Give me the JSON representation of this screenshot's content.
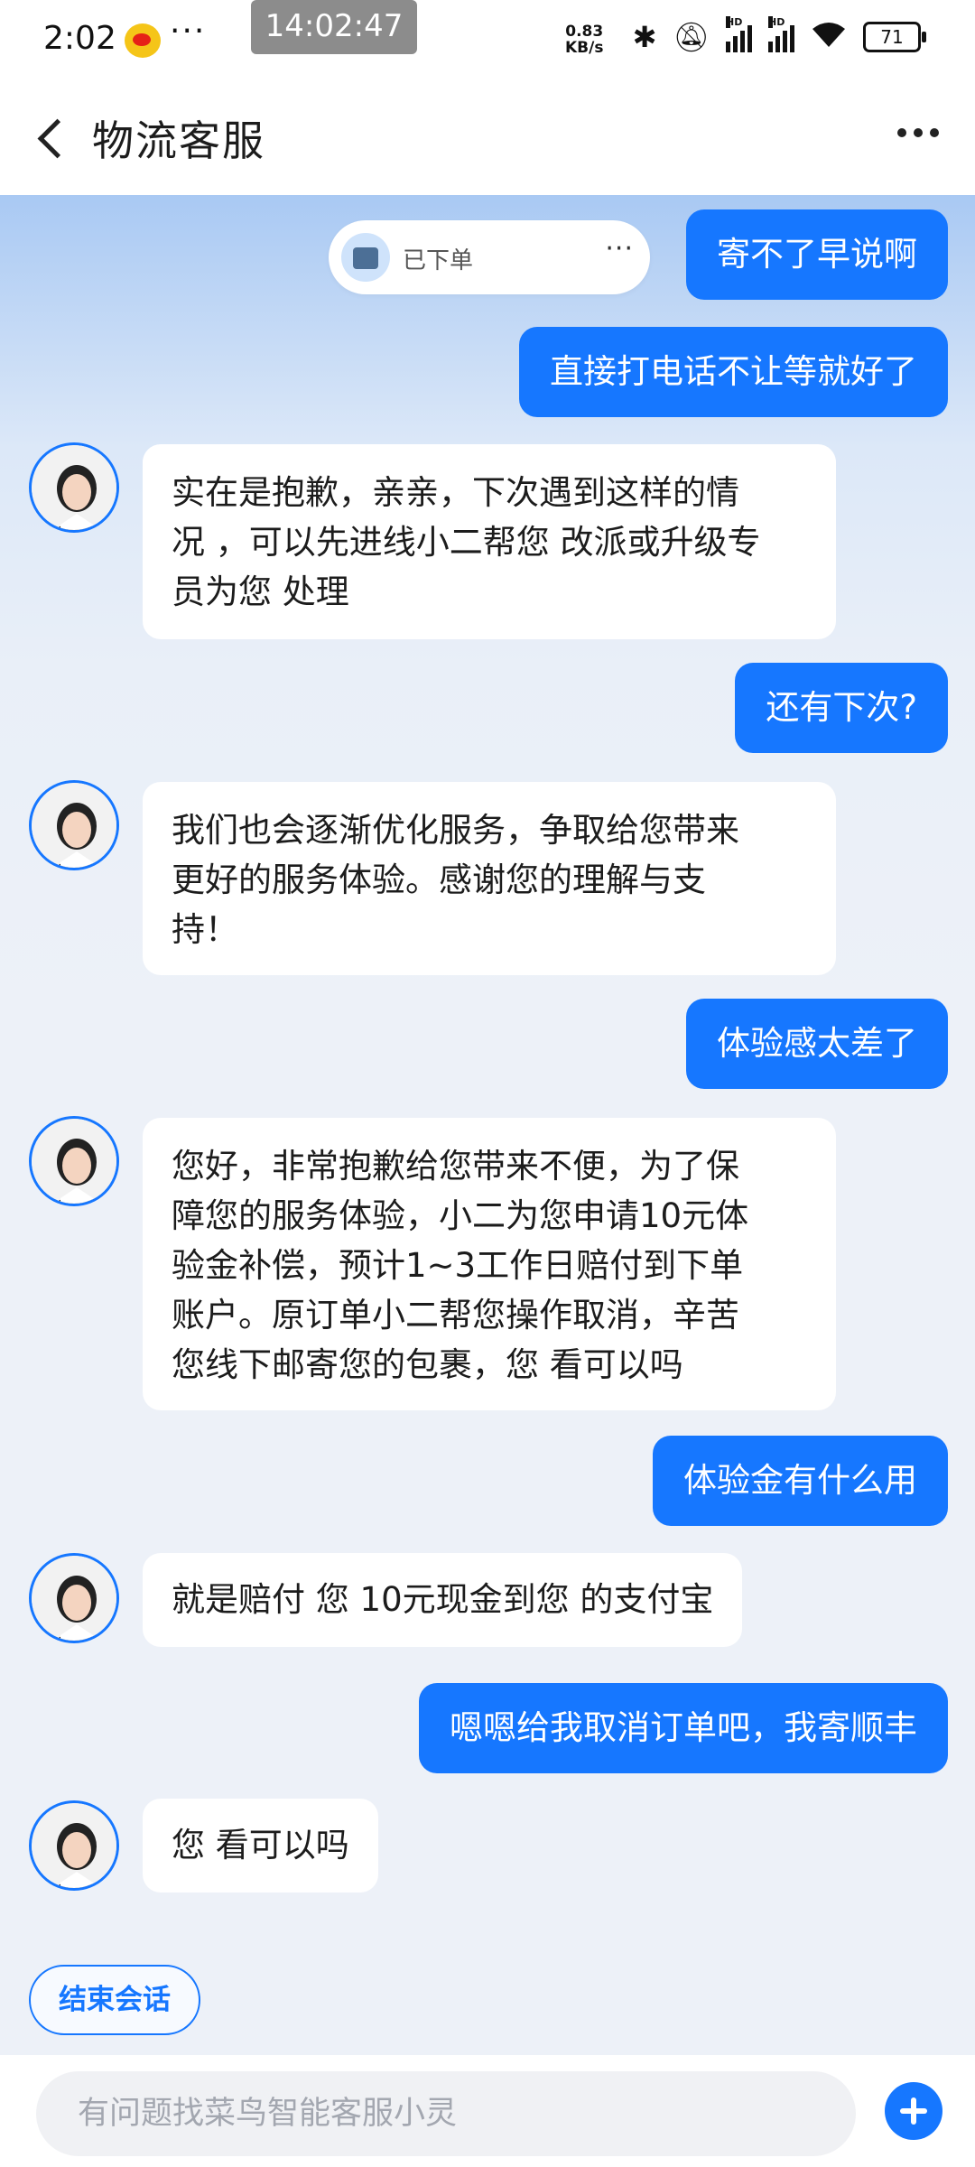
{
  "status_bar": {
    "time": "2:02",
    "overflow": "···",
    "clock": "14:02:47",
    "net_speed_value": "0.83",
    "net_speed_unit": "KB/s",
    "network_label": "HD",
    "battery": "71"
  },
  "header": {
    "title": "物流客服"
  },
  "order_card": {
    "status": "已下单",
    "more": "···"
  },
  "messages": [
    {
      "side": "right",
      "text": "寄不了早说啊"
    },
    {
      "side": "right",
      "text": "直接打电话不让等就好了"
    },
    {
      "side": "left",
      "lines": [
        "实在是抱歉，亲亲，下次遇到这样的情",
        "况 ，可以先进线小二帮您 改派或升级专",
        "员为您 处理"
      ]
    },
    {
      "side": "right",
      "text": "还有下次?"
    },
    {
      "side": "left",
      "lines": [
        "我们也会逐渐优化服务，争取给您带来",
        "更好的服务体验。感谢您的理解与支",
        "持！"
      ]
    },
    {
      "side": "right",
      "text": "体验感太差了"
    },
    {
      "side": "left",
      "lines": [
        "您好，非常抱歉给您带来不便，为了保",
        "障您的服务体验，小二为您申请10元体",
        "验金补偿，预计1~3工作日赔付到下单",
        "账户。原订单小二帮您操作取消，辛苦",
        "您线下邮寄您的包裹，您 看可以吗"
      ]
    },
    {
      "side": "right",
      "text": "体验金有什么用"
    },
    {
      "side": "left",
      "lines": [
        "就是赔付 您 10元现金到您 的支付宝"
      ]
    },
    {
      "side": "right",
      "text": "嗯嗯给我取消订单吧，我寄顺丰"
    },
    {
      "side": "left",
      "lines": [
        "您 看可以吗"
      ]
    }
  ],
  "end_button": "结束会话",
  "input": {
    "placeholder": "有问题找菜鸟智能客服小灵",
    "value": ""
  },
  "colors": {
    "accent": "#1677ff",
    "bubble_left": "#ffffff",
    "background": "#edf1f8"
  },
  "icons": [
    "back-arrow-icon",
    "more-icon",
    "avatar",
    "package-icon",
    "plus-icon",
    "bluetooth-icon",
    "mute-icon",
    "wifi-icon",
    "battery-icon"
  ]
}
